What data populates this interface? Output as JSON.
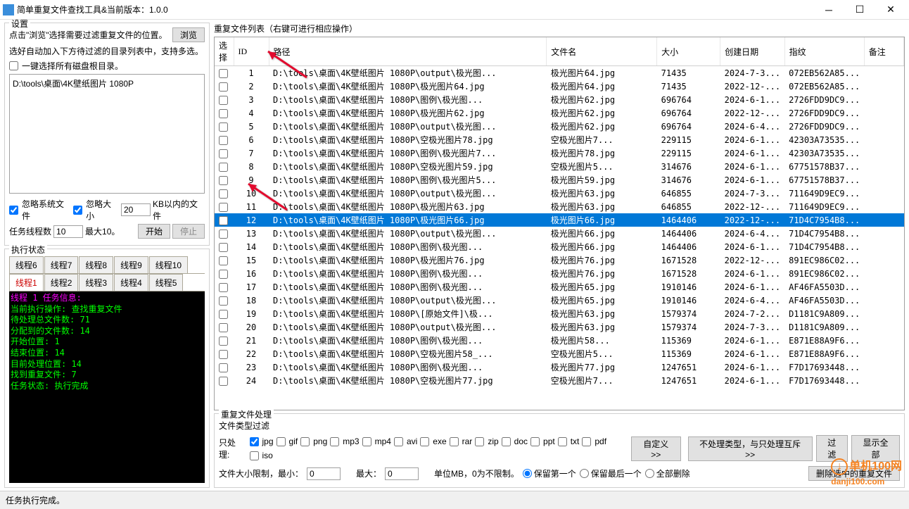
{
  "title": "简单重复文件查找工具&当前版本：1.0.0",
  "settings": {
    "group_title": "设置",
    "hint": "点击\"浏览\"选择需要过滤重复文件的位置。",
    "browse": "浏览",
    "hint2": "选好自动加入下方待过滤的目录列表中，支持多选。",
    "one_click": "一键选择所有磁盘根目录。",
    "path_item": "D:\\tools\\桌面\\4K壁纸图片 1080P",
    "ignore_sys": "忽略系统文件",
    "ignore_size": "忽略大小",
    "size_value": "20",
    "size_suffix": "KB以内的文件",
    "thread_label": "任务线程数",
    "thread_value": "10",
    "thread_max": "最大10。",
    "start": "开始",
    "stop": "停止"
  },
  "exec": {
    "title": "执行状态",
    "tabs_row2": [
      "线程6",
      "线程7",
      "线程8",
      "线程9",
      "线程10"
    ],
    "tabs_row1": [
      "线程1",
      "线程2",
      "线程3",
      "线程4",
      "线程5"
    ],
    "console_lines": [
      {
        "c": "magenta",
        "t": "线程 1 任务信息:"
      },
      {
        "c": "",
        "t": "当前执行操作: 查找重复文件"
      },
      {
        "c": "",
        "t": "待处理总文件数: 71"
      },
      {
        "c": "",
        "t": "分配到的文件数: 14"
      },
      {
        "c": "",
        "t": "开始位置: 1"
      },
      {
        "c": "",
        "t": "结束位置: 14"
      },
      {
        "c": "",
        "t": "目前处理位置: 14"
      },
      {
        "c": "",
        "t": "找到重复文件: 7"
      },
      {
        "c": "",
        "t": "任务状态: 执行完成"
      }
    ]
  },
  "list": {
    "title": "重复文件列表（右键可进行相应操作）",
    "cols": [
      "选择",
      "ID",
      "路径",
      "文件名",
      "大小",
      "创建日期",
      "指纹",
      "备注"
    ],
    "rows": [
      {
        "id": 1,
        "path": "D:\\tools\\桌面\\4K壁纸图片 1080P\\output\\极光图...",
        "fn": "极光图片64.jpg",
        "sz": "71435",
        "dt": "2024-7-3...",
        "h": "072EB562A85..."
      },
      {
        "id": 2,
        "path": "D:\\tools\\桌面\\4K壁纸图片 1080P\\极光图片64.jpg",
        "fn": "极光图片64.jpg",
        "sz": "71435",
        "dt": "2022-12-...",
        "h": "072EB562A85..."
      },
      {
        "id": 3,
        "path": "D:\\tools\\桌面\\4K壁纸图片 1080P\\图例\\极光图...",
        "fn": "极光图片62.jpg",
        "sz": "696764",
        "dt": "2024-6-1...",
        "h": "2726FDD9DC9..."
      },
      {
        "id": 4,
        "path": "D:\\tools\\桌面\\4K壁纸图片 1080P\\极光图片62.jpg",
        "fn": "极光图片62.jpg",
        "sz": "696764",
        "dt": "2022-12-...",
        "h": "2726FDD9DC9..."
      },
      {
        "id": 5,
        "path": "D:\\tools\\桌面\\4K壁纸图片 1080P\\output\\极光图...",
        "fn": "极光图片62.jpg",
        "sz": "696764",
        "dt": "2024-6-4...",
        "h": "2726FDD9DC9..."
      },
      {
        "id": 6,
        "path": "D:\\tools\\桌面\\4K壁纸图片 1080P\\空极光图片78.jpg",
        "fn": "空极光图片7...",
        "sz": "229115",
        "dt": "2024-6-1...",
        "h": "42303A73535..."
      },
      {
        "id": 7,
        "path": "D:\\tools\\桌面\\4K壁纸图片 1080P\\图例\\极光图片7...",
        "fn": "极光图片78.jpg",
        "sz": "229115",
        "dt": "2024-6-1...",
        "h": "42303A73535..."
      },
      {
        "id": 8,
        "path": "D:\\tools\\桌面\\4K壁纸图片 1080P\\空极光图片59.jpg",
        "fn": "空极光图片5...",
        "sz": "314676",
        "dt": "2024-6-1...",
        "h": "67751578B37..."
      },
      {
        "id": 9,
        "path": "D:\\tools\\桌面\\4K壁纸图片 1080P\\图例\\极光图片5...",
        "fn": "极光图片59.jpg",
        "sz": "314676",
        "dt": "2024-6-1...",
        "h": "67751578B37..."
      },
      {
        "id": 10,
        "path": "D:\\tools\\桌面\\4K壁纸图片 1080P\\output\\极光图...",
        "fn": "极光图片63.jpg",
        "sz": "646855",
        "dt": "2024-7-3...",
        "h": "711649D9EC9..."
      },
      {
        "id": 11,
        "path": "D:\\tools\\桌面\\4K壁纸图片 1080P\\极光图片63.jpg",
        "fn": "极光图片63.jpg",
        "sz": "646855",
        "dt": "2022-12-...",
        "h": "711649D9EC9..."
      },
      {
        "id": 12,
        "path": "D:\\tools\\桌面\\4K壁纸图片 1080P\\极光图片66.jpg",
        "fn": "极光图片66.jpg",
        "sz": "1464406",
        "dt": "2022-12-...",
        "h": "71D4C7954B8...",
        "sel": true
      },
      {
        "id": 13,
        "path": "D:\\tools\\桌面\\4K壁纸图片 1080P\\output\\极光图...",
        "fn": "极光图片66.jpg",
        "sz": "1464406",
        "dt": "2024-6-4...",
        "h": "71D4C7954B8..."
      },
      {
        "id": 14,
        "path": "D:\\tools\\桌面\\4K壁纸图片 1080P\\图例\\极光图...",
        "fn": "极光图片66.jpg",
        "sz": "1464406",
        "dt": "2024-6-1...",
        "h": "71D4C7954B8..."
      },
      {
        "id": 15,
        "path": "D:\\tools\\桌面\\4K壁纸图片 1080P\\极光图片76.jpg",
        "fn": "极光图片76.jpg",
        "sz": "1671528",
        "dt": "2022-12-...",
        "h": "891EC986C02..."
      },
      {
        "id": 16,
        "path": "D:\\tools\\桌面\\4K壁纸图片 1080P\\图例\\极光图...",
        "fn": "极光图片76.jpg",
        "sz": "1671528",
        "dt": "2024-6-1...",
        "h": "891EC986C02..."
      },
      {
        "id": 17,
        "path": "D:\\tools\\桌面\\4K壁纸图片 1080P\\图例\\极光图...",
        "fn": "极光图片65.jpg",
        "sz": "1910146",
        "dt": "2024-6-1...",
        "h": "AF46FA5503D..."
      },
      {
        "id": 18,
        "path": "D:\\tools\\桌面\\4K壁纸图片 1080P\\output\\极光图...",
        "fn": "极光图片65.jpg",
        "sz": "1910146",
        "dt": "2024-6-4...",
        "h": "AF46FA5503D..."
      },
      {
        "id": 19,
        "path": "D:\\tools\\桌面\\4K壁纸图片 1080P\\[原始文件]\\极...",
        "fn": "极光图片63.jpg",
        "sz": "1579374",
        "dt": "2024-7-2...",
        "h": "D1181C9A809..."
      },
      {
        "id": 20,
        "path": "D:\\tools\\桌面\\4K壁纸图片 1080P\\output\\极光图...",
        "fn": "极光图片63.jpg",
        "sz": "1579374",
        "dt": "2024-7-3...",
        "h": "D1181C9A809..."
      },
      {
        "id": 21,
        "path": "D:\\tools\\桌面\\4K壁纸图片 1080P\\图例\\极光图...",
        "fn": "极光图片58...",
        "sz": "115369",
        "dt": "2024-6-1...",
        "h": "E871E88A9F6..."
      },
      {
        "id": 22,
        "path": "D:\\tools\\桌面\\4K壁纸图片 1080P\\空极光图片58_...",
        "fn": "空极光图片5...",
        "sz": "115369",
        "dt": "2024-6-1...",
        "h": "E871E88A9F6..."
      },
      {
        "id": 23,
        "path": "D:\\tools\\桌面\\4K壁纸图片 1080P\\图例\\极光图...",
        "fn": "极光图片77.jpg",
        "sz": "1247651",
        "dt": "2024-6-1...",
        "h": "F7D17693448..."
      },
      {
        "id": 24,
        "path": "D:\\tools\\桌面\\4K壁纸图片 1080P\\空极光图片77.jpg",
        "fn": "空极光图片7...",
        "sz": "1247651",
        "dt": "2024-6-1...",
        "h": "F7D17693448..."
      }
    ]
  },
  "process": {
    "title": "重复文件处理",
    "filter_title": "文件类型过滤",
    "only_label": "只处理:",
    "types": [
      "jpg",
      "gif",
      "png",
      "mp3",
      "mp4",
      "avi",
      "exe",
      "rar",
      "zip",
      "doc",
      "ppt",
      "txt",
      "pdf",
      "iso"
    ],
    "custom": "自定义>>",
    "no_types": "不处理类型，与只处理互斥>>",
    "filter": "过滤",
    "show_all": "显示全部",
    "size_label_1": "文件大小限制，最小：",
    "size_min": "0",
    "size_label_2": "最大：",
    "size_max": "0",
    "size_unit": "单位MB，0为不限制。",
    "keep_first": "保留第一个",
    "keep_last": "保留最后一个",
    "delete_all": "全部删除",
    "delete_selected": "删除选中的重复文件"
  },
  "statusbar": "任务执行完成。",
  "watermark": {
    "brand": "单机100网",
    "url": "danji100.com"
  }
}
